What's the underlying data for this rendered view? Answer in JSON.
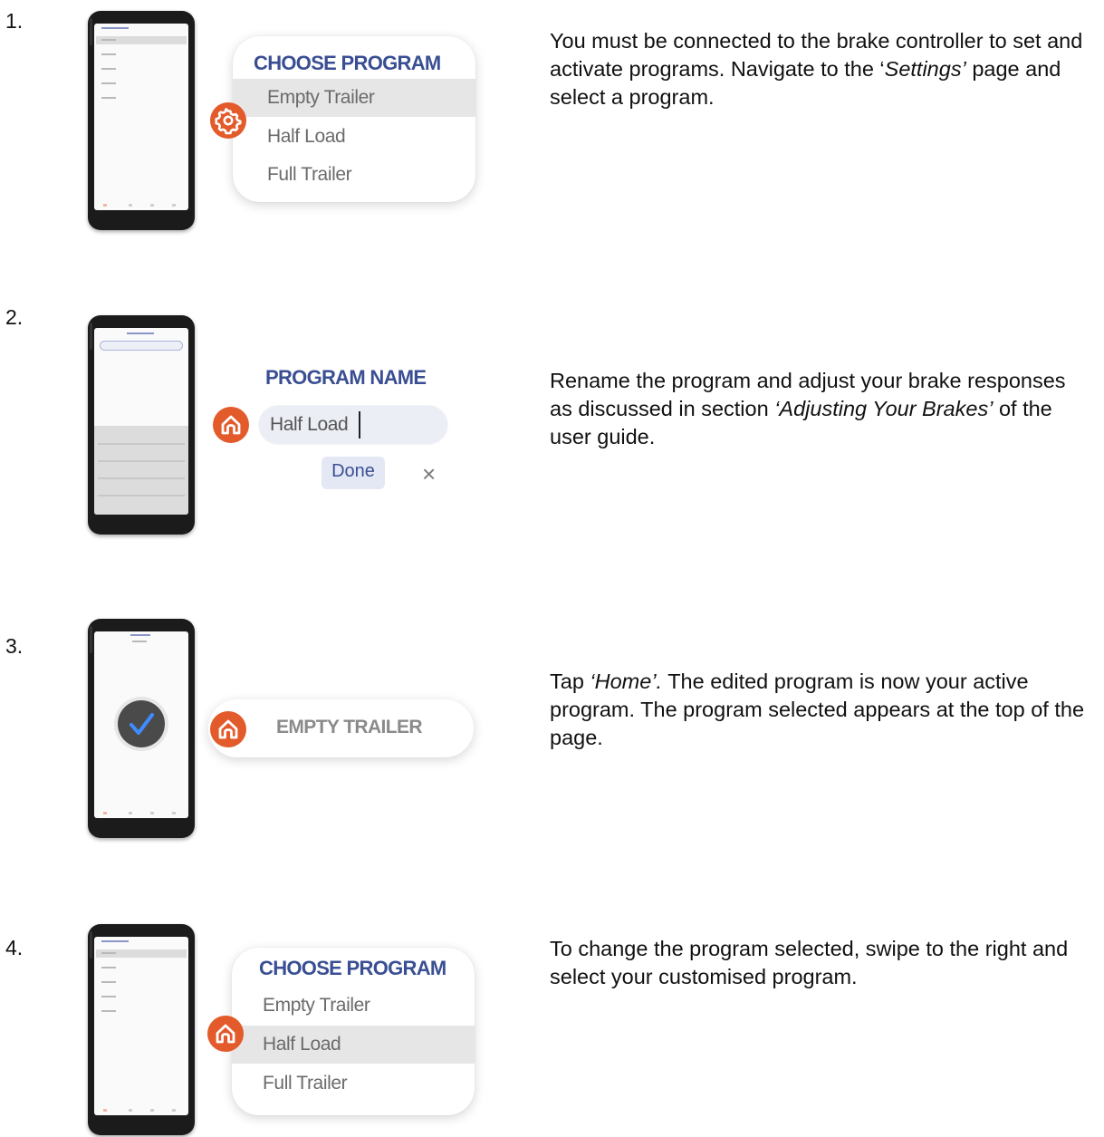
{
  "steps": [
    {
      "number": "1.",
      "description_parts": [
        "You must be connected to the brake controller to set and activate programs. Navigate to the ‘",
        "Settings’",
        " page and select a program."
      ],
      "card": {
        "title": "CHOOSE PROGRAM",
        "options": [
          "Empty Trailer",
          "Half Load",
          "Full Trailer"
        ],
        "selected_option": "Empty Trailer",
        "icon": "gear-icon"
      }
    },
    {
      "number": "2.",
      "description_parts": [
        "Rename the program and adjust your brake responses as discussed in section ",
        "‘Adjusting Your Brakes’",
        " of the user guide."
      ],
      "card": {
        "title": "PROGRAM NAME",
        "input_value": "Half Load",
        "done_label": "Done",
        "close_glyph": "×",
        "icon": "home-icon"
      }
    },
    {
      "number": "3.",
      "description_parts": [
        "Tap ",
        "‘Home’.",
        " The edited program is now your active program. The program selected appears at the top of the page."
      ],
      "card": {
        "label": "EMPTY TRAILER",
        "icon": "home-icon"
      }
    },
    {
      "number": "4.",
      "description_parts": [
        "To change the program selected, swipe to the right and select your customised program."
      ],
      "card": {
        "title": "CHOOSE PROGRAM",
        "options": [
          "Empty Trailer",
          "Half Load",
          "Full Trailer"
        ],
        "selected_option": "Half Load",
        "icon": "home-icon"
      }
    }
  ],
  "colors": {
    "accent_orange": "#e35a2b",
    "title_blue": "#3a4f93",
    "check_blue": "#3f8bff"
  }
}
